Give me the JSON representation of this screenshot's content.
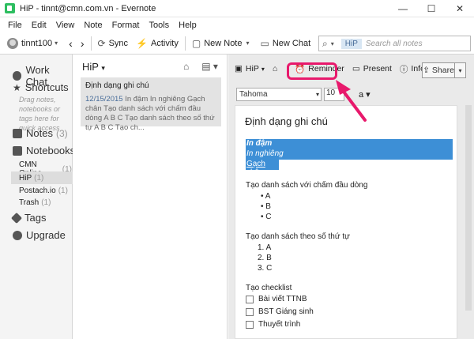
{
  "window": {
    "title": "HiP - tinnt@cmn.com.vn - Evernote",
    "min": "—",
    "max": "☐",
    "close": "✕"
  },
  "menu": [
    "File",
    "Edit",
    "View",
    "Note",
    "Format",
    "Tools",
    "Help"
  ],
  "toolbar": {
    "account": "tinnt100",
    "sync": "Sync",
    "activity": "Activity",
    "new_note": "New Note",
    "new_chat": "New Chat"
  },
  "search": {
    "chip": "HiP",
    "placeholder": "Search all notes"
  },
  "sidebar": {
    "work_chat": "Work Chat",
    "shortcuts": "Shortcuts",
    "shortcuts_hint": "Drag notes, notebooks or tags here for quick access",
    "notes": "Notes",
    "notes_count": "(3)",
    "notebooks": "Notebooks",
    "notebook_items": [
      {
        "name": "CMN Online",
        "count": "(1)"
      },
      {
        "name": "HiP",
        "count": "(1)"
      },
      {
        "name": "Postach.io",
        "count": "(1)"
      },
      {
        "name": "Trash",
        "count": "(1)"
      }
    ],
    "tags": "Tags",
    "upgrade": "Upgrade"
  },
  "notelist": {
    "title": "HiP",
    "note": {
      "title": "Định dạng ghi chú",
      "date": "12/15/2015",
      "snippet": "In đậm In nghiêng Gạch chân Tạo danh sách với chấm đầu dòng A B C Tạo danh sách theo số thứ tự A B C Tạo ch..."
    }
  },
  "editor": {
    "notebook": "HiP",
    "reminder": "Reminder",
    "present": "Present",
    "info": "Info",
    "share": "Share",
    "font": "Tahoma",
    "size": "10",
    "doc": {
      "title": "Định dạng ghi chú",
      "bold": "In đậm",
      "italic": "In nghiêng",
      "underline": "Gạch chân",
      "bullet_heading": "Tạo danh sách với chấm đầu dòng",
      "bullets": [
        "A",
        "B",
        "C"
      ],
      "numbered_heading": "Tạo danh sách theo số thứ tự",
      "numbered": [
        "1.  A",
        "2.  B",
        "3.  C"
      ],
      "checklist_heading": "Tạo checklist",
      "checklist": [
        "Bài viết TTNB",
        "BST Giáng sinh",
        "Thuyết trình"
      ]
    }
  },
  "colors": {
    "highlight": "#3d8fd6",
    "annotation": "#e8196c"
  }
}
